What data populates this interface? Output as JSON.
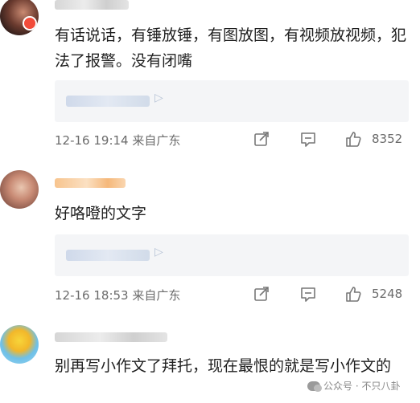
{
  "comments": [
    {
      "text": "有话说话，有锤放锤，有图放图，有视频放视频，犯法了报警。没有闭嘴",
      "time_location": "12-16 19:14 来自广东",
      "like_count": "8352",
      "quote_arrow": "▷"
    },
    {
      "text": "好咯噔的文字",
      "time_location": "12-16 18:53 来自广东",
      "like_count": "5248",
      "quote_arrow": "▷"
    },
    {
      "text": "别再写小作文了拜托，现在最恨的就是写小作文的"
    }
  ],
  "watermark": {
    "text": "公众号 · 不只八卦"
  },
  "icons": [
    "share-icon",
    "reply-icon",
    "like-icon",
    "wechat-logo-icon"
  ],
  "colors": {
    "meta_text": "#6b6b6b",
    "quote_bg": "#f4f5f7",
    "badge_red": "#f24b3a"
  }
}
